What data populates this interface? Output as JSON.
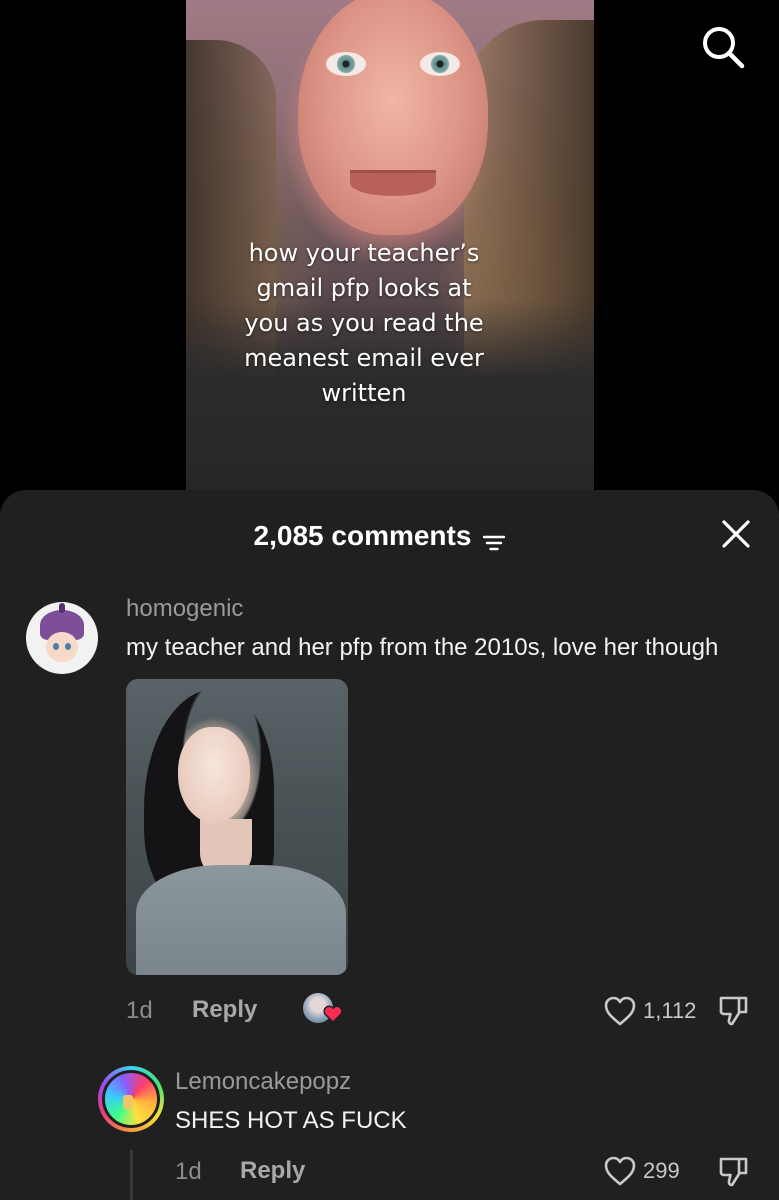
{
  "video": {
    "caption_lines": [
      "how your teacher’s",
      "gmail pfp looks at",
      "you as you read the",
      "meanest email ever",
      "written"
    ]
  },
  "header": {
    "comment_count": "2,085 comments"
  },
  "comments": [
    {
      "username": "homogenic",
      "text": "my teacher and her pfp from the 2010s, love her though",
      "time": "1d",
      "reply_label": "Reply",
      "likes": "1,112"
    },
    {
      "username": "Lemoncakepopz",
      "text": "SHES HOT AS FUCK",
      "time": "1d",
      "reply_label": "Reply",
      "likes": "299"
    }
  ],
  "icons": {
    "search": "search-icon",
    "sort": "sort-icon",
    "close": "close-icon",
    "like": "heart-icon",
    "dislike": "thumbs-down-icon"
  },
  "colors": {
    "sheet_bg": "#202021",
    "username": "#9a9a9c",
    "creator_heart": "#fe2c55"
  }
}
